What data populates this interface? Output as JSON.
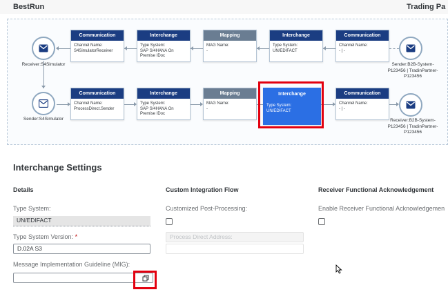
{
  "header": {
    "brand": "BestRun",
    "right_title": "Trading Pa"
  },
  "flow": {
    "row1": {
      "start_node": {
        "label": "Receiver:S4Simulator",
        "icon": "mail-icon"
      },
      "end_node": {
        "label_lines": [
          "Sender:B2B-System-",
          "P123456 | TradinPartner-",
          "P123456"
        ],
        "icon": "mail-icon"
      },
      "steps": [
        {
          "title": "Communication",
          "lines": [
            "Channel Name:",
            "S4SimulatorReceiver"
          ]
        },
        {
          "title": "Interchange",
          "lines": [
            "Type System:",
            "SAP S/4HANA On",
            "Premise IDoc"
          ]
        },
        {
          "title": "Mapping",
          "lines": [
            "MAG Name:",
            "-"
          ]
        },
        {
          "title": "Interchange",
          "lines": [
            "Type System:",
            "UN/EDIFACT"
          ]
        },
        {
          "title": "Communication",
          "lines": [
            "Channel Name:",
            "- | -"
          ]
        }
      ]
    },
    "row2": {
      "start_node": {
        "label": "Sender:S4Simulator",
        "icon": "mail-icon"
      },
      "end_node": {
        "label_lines": [
          "Receiver:B2B-System-",
          "P123456 | TradinPartner-",
          "P123456"
        ],
        "icon": "mail-icon"
      },
      "steps": [
        {
          "title": "Communication",
          "lines": [
            "Channel Name:",
            "ProcessDirect.Sender"
          ]
        },
        {
          "title": "Interchange",
          "lines": [
            "Type System:",
            "SAP S/4HANA On",
            "Premise IDoc"
          ]
        },
        {
          "title": "Mapping",
          "lines": [
            "MAG Name:",
            "-"
          ]
        },
        {
          "title": "Interchange",
          "lines": [
            "Type System:",
            "UN/EDIFACT"
          ]
        },
        {
          "title": "Communication",
          "lines": [
            "Channel Name:",
            "- | -"
          ]
        }
      ]
    }
  },
  "settings": {
    "title": "Interchange Settings",
    "details": {
      "title": "Details",
      "type_system_label": "Type System:",
      "type_system_value": "UN/EDIFACT",
      "type_system_version_label": "Type System Version:",
      "required_marker": "*",
      "type_system_version_value": "D.02A S3",
      "mig_label": "Message Implementation Guideline (MIG):",
      "mig_value": ""
    },
    "custom_flow": {
      "title": "Custom Integration Flow",
      "post_processing_label": "Customized Post-Processing:",
      "post_processing_checked": false,
      "process_direct_placeholder": "Process Direct Address:"
    },
    "receiver_ack": {
      "title": "Receiver Functional Acknowledgement",
      "enable_label": "Enable Receiver Functional Acknowledgemen",
      "enable_checked": false
    }
  },
  "colors": {
    "step_header": "#1b3d82",
    "mapping_header": "#6a7d92",
    "selected_step": "#2b6fe4",
    "highlight": "#e3000f"
  }
}
